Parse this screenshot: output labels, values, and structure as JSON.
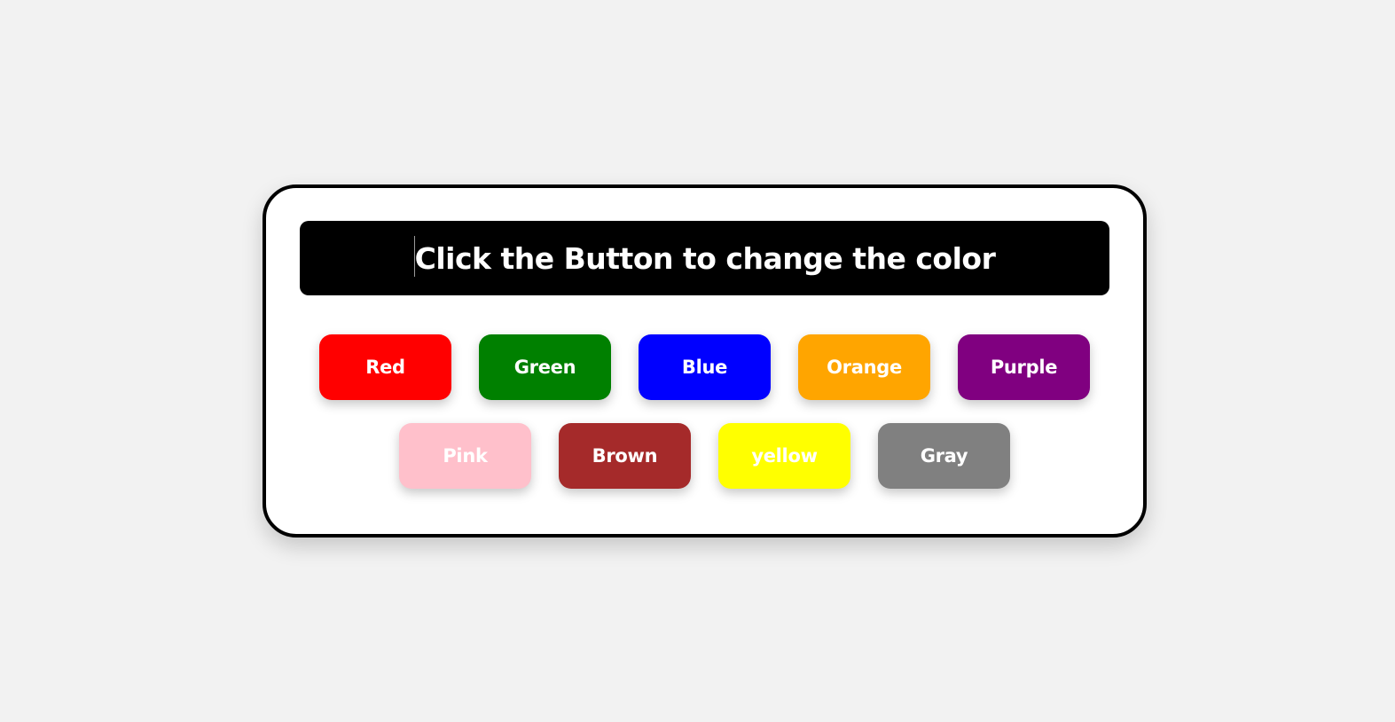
{
  "banner": {
    "text": "Click the Button to change the color"
  },
  "buttons": {
    "row1": [
      {
        "label": "Red",
        "color": "#ff0000"
      },
      {
        "label": "Green",
        "color": "#008000"
      },
      {
        "label": "Blue",
        "color": "#0000ff"
      },
      {
        "label": "Orange",
        "color": "#ffa500"
      },
      {
        "label": "Purple",
        "color": "#800080"
      }
    ],
    "row2": [
      {
        "label": "Pink",
        "color": "#ffc0cb"
      },
      {
        "label": "Brown",
        "color": "#a52a2a"
      },
      {
        "label": "yellow",
        "color": "#ffff00"
      },
      {
        "label": "Gray",
        "color": "#808080"
      }
    ]
  },
  "colors": {
    "page_background": "#f2f2f2",
    "card_background": "#ffffff",
    "card_border": "#000000",
    "banner_background": "#000000",
    "banner_text": "#ffffff",
    "button_text": "#ffffff"
  }
}
